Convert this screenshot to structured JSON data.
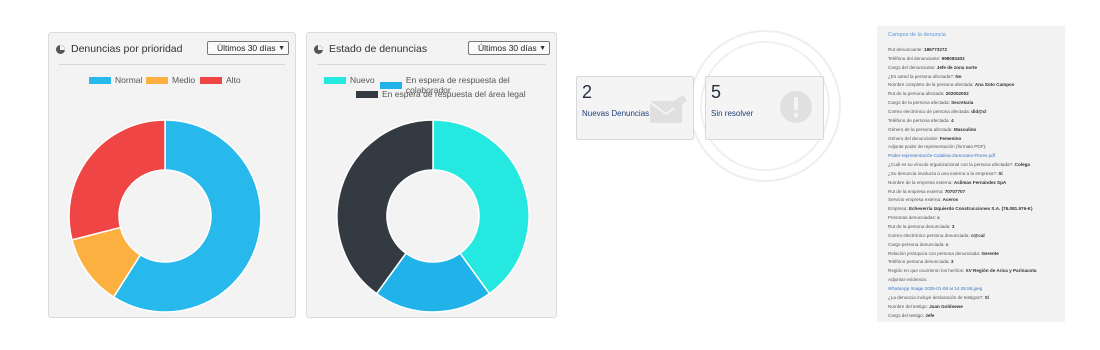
{
  "priority_panel": {
    "title": "Denuncias por prioridad",
    "range": "Últimos 30 días",
    "legend": [
      "Normal",
      "Medio",
      "Alto"
    ]
  },
  "status_panel": {
    "title": "Estado de denuncias",
    "range": "Últimos 30 días",
    "legend": [
      "Nuevo",
      "En espera de respuesta del colaborador",
      "En espera de respuesta del área legal"
    ]
  },
  "cards": {
    "new_count": "2",
    "new_label": "Nuevas Denuncias",
    "unresolved_count": "5",
    "unresolved_label": "Sin resolver"
  },
  "detail": {
    "title": "Campos de la denuncia",
    "rows": [
      {
        "label": "Rut denunciante:",
        "value": "186773272"
      },
      {
        "label": "Teléfono del denunciante:",
        "value": "998083402"
      },
      {
        "label": "Cargo del denunciante:",
        "value": "Jefe de zona norte"
      },
      {
        "label": "¿Es usted la persona afectada?:",
        "value": "No"
      },
      {
        "label": "Nombre completo de la persona afectada:",
        "value": "Ana Soto Campos"
      },
      {
        "label": "Rut de la persona afectada:",
        "value": "202002002"
      },
      {
        "label": "Cargo de la persona afectada:",
        "value": "Secretaria"
      },
      {
        "label": "Correo electrónico de persona afectada:",
        "value": "did@cl"
      },
      {
        "label": "Teléfono de persona afectada:",
        "value": "4"
      },
      {
        "label": "Género de la persona afectada:",
        "value": "Masculino"
      },
      {
        "label": "Género del denunciante:",
        "value": "Femenino"
      },
      {
        "label": "Adjunte poder de representación (formato PDF):",
        "value": ""
      },
      {
        "label": "",
        "value": "",
        "link": "Poder-representación-Catalina-Zamorano-Flores.pdf"
      },
      {
        "label": "¿Cuál es su vínculo organizacional con la persona afectada?:",
        "value": "Colega"
      },
      {
        "label": "¿Su denuncia involucra a una externa a la empresa?:",
        "value": "Sí"
      },
      {
        "label": "Nombre de la empresa externa:",
        "value": "Aclimas Fernández SpA"
      },
      {
        "label": "Rut de la empresa externa:",
        "value": "70707707"
      },
      {
        "label": "Servicio empresa externa:",
        "value": "Aceros"
      },
      {
        "label": "Empresa:",
        "value": "Echeverría Izquierdo Construcciones S.A. (76.081.976-K)"
      },
      {
        "label": "Personas denunciadas:",
        "value": "c"
      },
      {
        "label": "Rut de la persona denunciada:",
        "value": "3"
      },
      {
        "label": "Correo electrónico persona denunciada:",
        "value": "o@cal"
      },
      {
        "label": "Cargo persona denunciada:",
        "value": "c"
      },
      {
        "label": "Relación jerárquica con persona denunciada:",
        "value": "Gerente"
      },
      {
        "label": "Teléfono persona denunciada:",
        "value": "3"
      },
      {
        "label": "Región en que ocurrieron los hechos:",
        "value": "XV Región de Arica y Parinacota"
      },
      {
        "label": "Adjuntar evidencia:",
        "value": ""
      },
      {
        "label": "",
        "value": "",
        "link": "WhatsApp Image 2025-01-08 at 14.35.56.jpeg"
      },
      {
        "label": "¿La denuncia incluye declaración de testigos?:",
        "value": "Sí"
      },
      {
        "label": "Nombre del testigo:",
        "value": "Juan Goldsewe"
      },
      {
        "label": "Cargo del testigo:",
        "value": "Jefe"
      }
    ]
  },
  "chart_data": [
    {
      "type": "pie",
      "categories": [
        "Normal",
        "Medio",
        "Alto"
      ],
      "values": [
        59,
        12,
        29
      ],
      "colors": [
        "#27b9ec",
        "#fbb040",
        "#ef4545"
      ],
      "donut": true
    },
    {
      "type": "pie",
      "categories": [
        "Nuevo",
        "En espera de respuesta del colaborador",
        "En espera de respuesta del área legal"
      ],
      "values": [
        40,
        20,
        40
      ],
      "colors": [
        "#25e8e0",
        "#22b2ea",
        "#343a42"
      ],
      "donut": true
    }
  ]
}
